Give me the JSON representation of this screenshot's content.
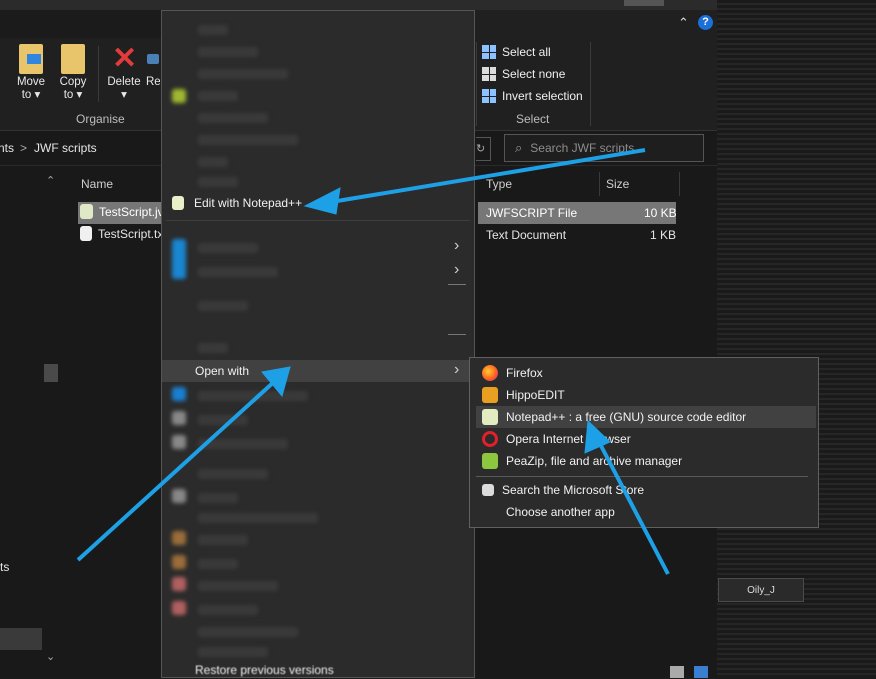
{
  "ribbon": {
    "buttons": [
      {
        "label": "Move",
        "sub": "to ▾"
      },
      {
        "label": "Copy",
        "sub": "to ▾"
      },
      {
        "label": "Delete",
        "sub": "▾"
      },
      {
        "label": "Re"
      }
    ],
    "organise_label": "Organise",
    "select_items": [
      "Select all",
      "Select none",
      "Invert selection"
    ],
    "select_label": "Select"
  },
  "address": {
    "crumb_prefix": "nts",
    "crumb": "JWF scripts",
    "sep": ">"
  },
  "search": {
    "placeholder": "Search JWF scripts"
  },
  "columns": {
    "name": "Name",
    "type": "Type",
    "size": "Size"
  },
  "files": [
    {
      "name": "TestScript.jv",
      "type": "JWFSCRIPT File",
      "size": "10 KB"
    },
    {
      "name": "TestScript.tx",
      "type": "Text Document",
      "size": "1 KB"
    }
  ],
  "nav": {
    "partial_label": "ts"
  },
  "context_menu": {
    "edit_notepad": "Edit with Notepad++",
    "open_with": "Open with",
    "restore": "Restore previous versions"
  },
  "open_with_menu": {
    "apps": [
      "Firefox",
      "HippoEDIT",
      "Notepad++ : a free (GNU) source code editor",
      "Opera Internet Browser",
      "PeaZip, file and archive manager"
    ],
    "store": "Search the Microsoft Store",
    "choose": "Choose another app"
  },
  "taskbar": {
    "user": "Oily_J"
  },
  "colors": {
    "arrow": "#1ea0e6",
    "accent": "#0a6cd6",
    "highlight": "#414141"
  }
}
